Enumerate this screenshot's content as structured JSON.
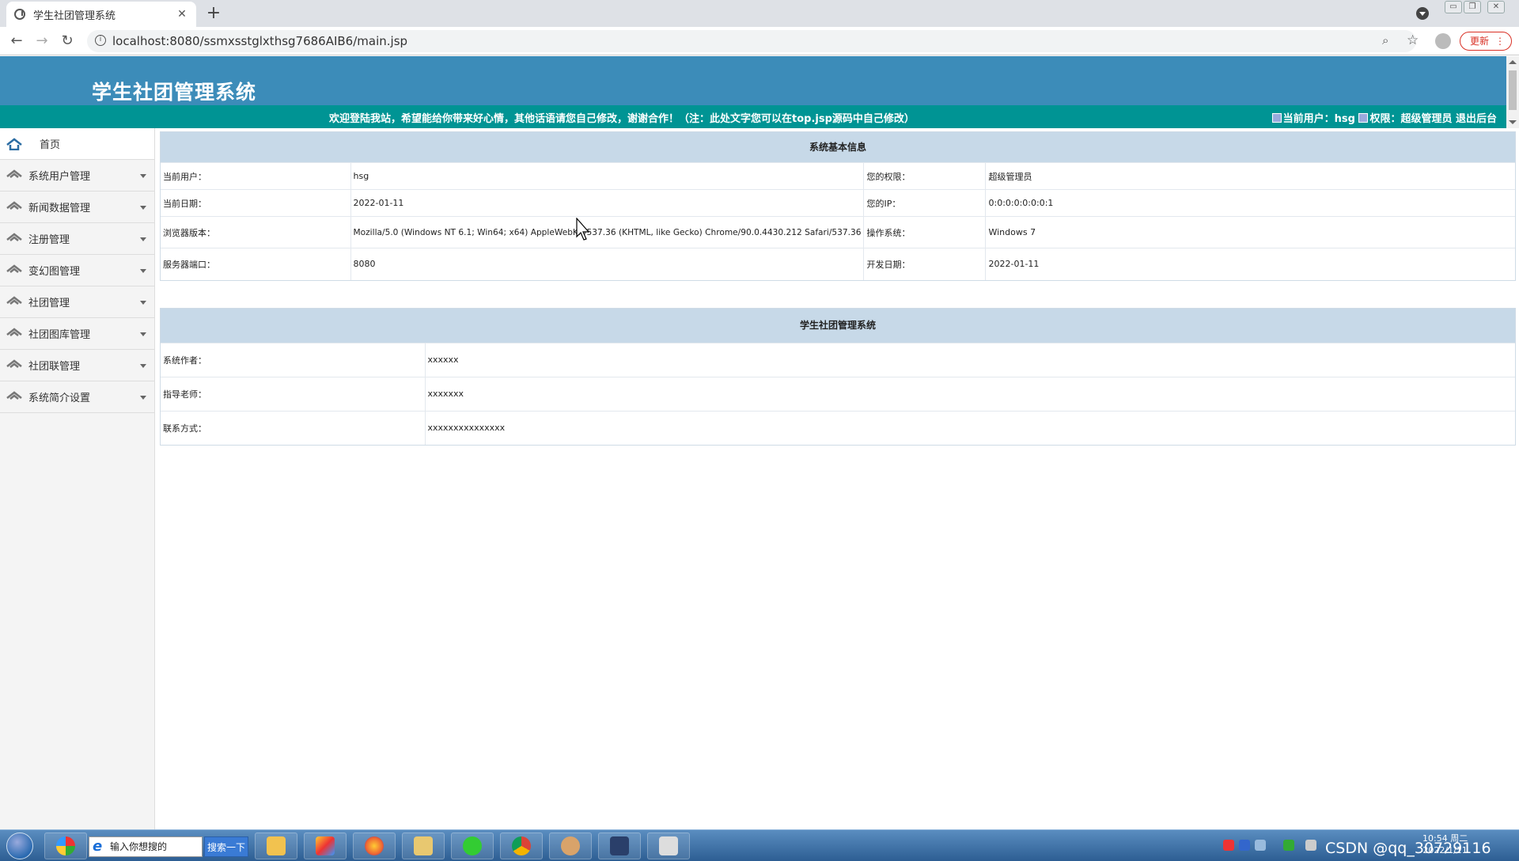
{
  "browser": {
    "tab_title": "学生社团管理系统",
    "tab_close": "✕",
    "new_tab": "+",
    "url": "localhost:8080/ssmxsstglxthsg7686AIB6/main.jsp",
    "update_label": "更新",
    "window_controls": [
      "▭",
      "❐",
      "✕"
    ]
  },
  "header": {
    "title": "学生社团管理系统",
    "welcome": "欢迎登陆我站，希望能给你带来好心情，其他话语请您自己修改，谢谢合作！（注：此处文字您可以在top.jsp源码中自己修改）",
    "current_user_label": "当前用户：hsg",
    "role_label": "权限：超级管理员",
    "back_link": "退出后台"
  },
  "sidebar": {
    "items": [
      {
        "label": "首页"
      },
      {
        "label": "系统用户管理"
      },
      {
        "label": "新闻数据管理"
      },
      {
        "label": "注册管理"
      },
      {
        "label": "变幻图管理"
      },
      {
        "label": "社团管理"
      },
      {
        "label": "社团图库管理"
      },
      {
        "label": "社团联管理"
      },
      {
        "label": "系统简介设置"
      }
    ]
  },
  "system_info": {
    "title": "系统基本信息",
    "rows": [
      {
        "k1": "当前用户：",
        "v1": "hsg",
        "k2": "您的权限：",
        "v2": "超级管理员"
      },
      {
        "k1": "当前日期：",
        "v1": "2022-01-11",
        "k2": "您的IP：",
        "v2": "0:0:0:0:0:0:0:1"
      },
      {
        "k1": "浏览器版本：",
        "v1": "Mozilla/5.0 (Windows NT 6.1; Win64; x64) AppleWebKit/537.36 (KHTML, like Gecko) Chrome/90.0.4430.212 Safari/537.36",
        "k2": "操作系统：",
        "v2": "Windows 7"
      },
      {
        "k1": "服务器端口：",
        "v1": "8080",
        "k2": "开发日期：",
        "v2": "2022-01-11"
      }
    ]
  },
  "about": {
    "title": "学生社团管理系统",
    "rows": [
      {
        "k": "系统作者：",
        "v": "xxxxxx"
      },
      {
        "k": "指导老师：",
        "v": "xxxxxxx"
      },
      {
        "k": "联系方式：",
        "v": "xxxxxxxxxxxxxxx"
      }
    ]
  },
  "taskbar": {
    "search_placeholder": "输入你想搜的",
    "search_button": "搜索一下",
    "tray_text": "CSDN @qq_30729116",
    "clock_time": "10:54 周二",
    "clock_date": "2022/1/11"
  },
  "colors": {
    "header_bg": "#3c8cb9",
    "welcome_bg": "#009494",
    "panel_head_bg": "#c7d9e8",
    "sidebar_bg": "#f4f4f4",
    "update_red": "#d93025"
  }
}
